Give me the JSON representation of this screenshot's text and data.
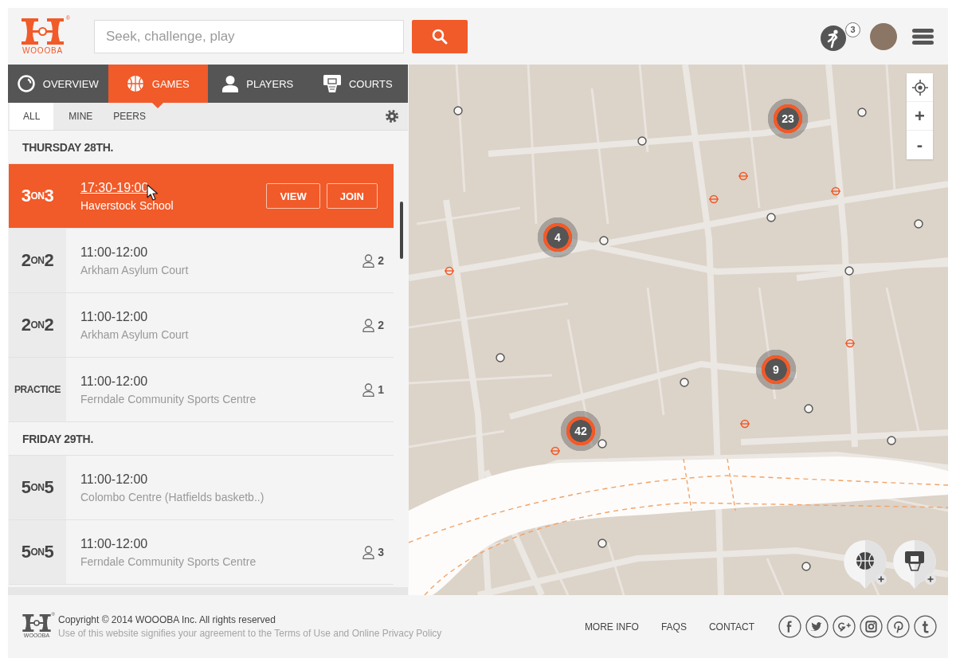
{
  "header": {
    "logo": {
      "name": "WOOOBA",
      "mark": "®"
    },
    "search": {
      "placeholder": "Seek, challenge, play"
    },
    "notifications": {
      "count": "3"
    }
  },
  "tabs": [
    {
      "label": "OVERVIEW",
      "kind": "ring",
      "selected": false
    },
    {
      "label": "GAMES",
      "kind": "ball",
      "selected": true
    },
    {
      "label": "PLAYERS",
      "kind": "person",
      "selected": false
    },
    {
      "label": "COURTS",
      "kind": "hoop",
      "selected": false
    }
  ],
  "filters": [
    {
      "label": "ALL",
      "selected": true
    },
    {
      "label": "MINE",
      "selected": false
    },
    {
      "label": "PEERS",
      "selected": false
    }
  ],
  "days": [
    {
      "heading": "THURSDAY 28TH.",
      "games": [
        {
          "format": [
            "3",
            "ON",
            "3"
          ],
          "time": "17:30-19:00",
          "venue": "Haverstock School",
          "selected": true,
          "hovered": true,
          "actions": [
            "VIEW",
            "JOIN"
          ]
        },
        {
          "format": [
            "2",
            "ON",
            "2"
          ],
          "time": "11:00-12:00",
          "venue": "Arkham Asylum Court",
          "selected": false,
          "hovered": false,
          "players": "2"
        },
        {
          "format": [
            "2",
            "ON",
            "2"
          ],
          "time": "11:00-12:00",
          "venue": "Arkham Asylum Court",
          "selected": false,
          "hovered": false,
          "players": "2"
        },
        {
          "format": [
            "PRACTICE"
          ],
          "time": "11:00-12:00",
          "venue": "Ferndale Community Sports Centre",
          "selected": false,
          "hovered": false,
          "players": "1"
        }
      ]
    },
    {
      "heading": "FRIDAY 29TH.",
      "games": [
        {
          "format": [
            "5",
            "ON",
            "5"
          ],
          "time": "11:00-12:00",
          "venue": "Colombo Centre (Hatfields basketb..)",
          "selected": false,
          "hovered": false
        },
        {
          "format": [
            "5",
            "ON",
            "5"
          ],
          "time": "11:00-12:00",
          "venue": "Ferndale Community Sports Centre",
          "selected": false,
          "hovered": false,
          "players": "3"
        }
      ]
    }
  ],
  "map": {
    "clusters": [
      {
        "count": "23"
      },
      {
        "count": "4"
      },
      {
        "count": "9"
      },
      {
        "count": "42"
      }
    ],
    "zoom": [
      "+",
      "-"
    ],
    "quick_add": [
      {
        "kind": "ball"
      },
      {
        "kind": "hoop"
      }
    ]
  },
  "footer": {
    "logo": {
      "name": "WOOOBA",
      "mark": "®"
    },
    "copyright": "Copyright © 2014 WOOOBA Inc. All rights reserved",
    "notice": "Use of this website signifies your agreement to the Terms of Use and Online Privacy Policy",
    "links": [
      "MORE INFO",
      "FAQS",
      "CONTACT"
    ],
    "social": [
      {
        "kind": "facebook"
      },
      {
        "kind": "twitter"
      },
      {
        "kind": "googleplus"
      },
      {
        "kind": "instagram"
      },
      {
        "kind": "pinterest"
      },
      {
        "kind": "tumblr"
      }
    ]
  }
}
